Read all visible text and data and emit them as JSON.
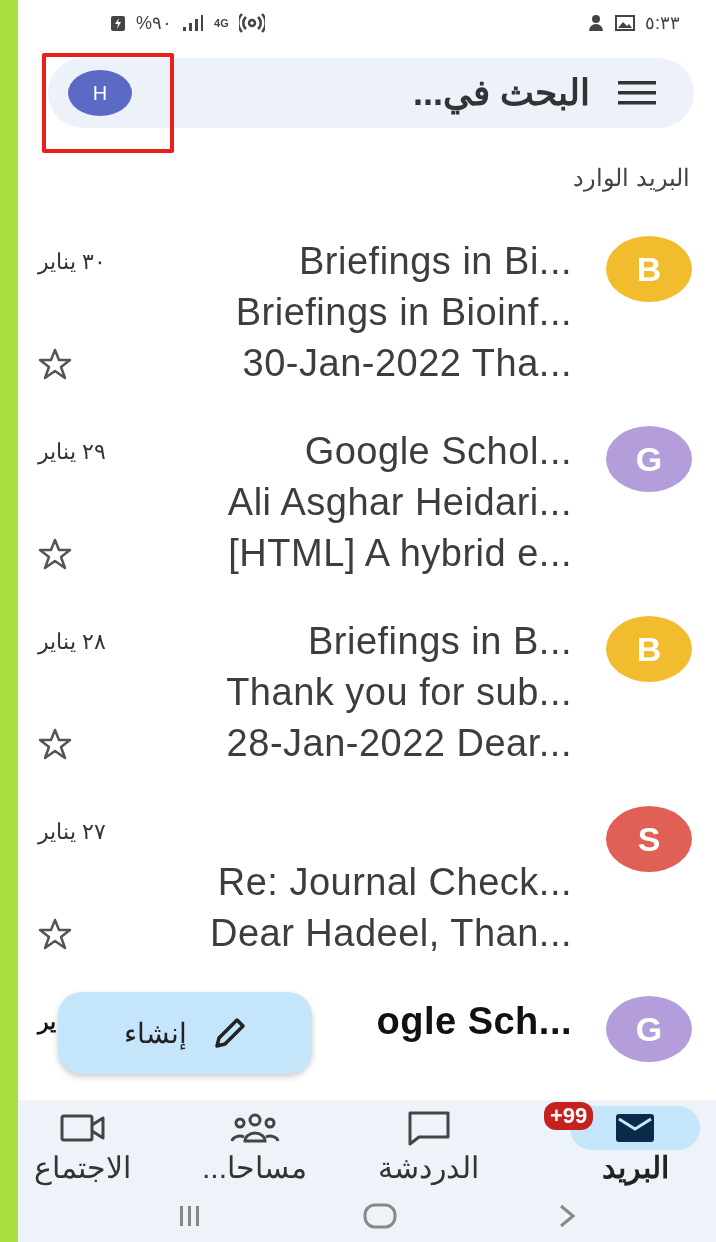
{
  "status_bar": {
    "battery": "%٩٠",
    "network": "4G",
    "time": "٥:٣٣"
  },
  "search": {
    "placeholder": "البحث في...",
    "avatar_letter": "H",
    "highlighted": true
  },
  "folder_label": "البريد الوارد",
  "emails": [
    {
      "avatar_letter": "B",
      "color": "#f2bc2f",
      "sender": "Briefings in Bi...",
      "date": "٣٠ يناير",
      "subject": "Briefings in Bioinf...",
      "preview": "30-Jan-2022 Tha...",
      "starred": false,
      "unread": false
    },
    {
      "avatar_letter": "G",
      "color": "#b39ddb",
      "sender": "Google Schol...",
      "date": "٢٩ يناير",
      "subject": "Ali Asghar Heidari...",
      "preview": "[HTML] A hybrid e...",
      "starred": false,
      "unread": false
    },
    {
      "avatar_letter": "B",
      "color": "#f2bc2f",
      "sender": "Briefings in B...",
      "date": "٢٨ يناير",
      "subject": "Thank you for sub...",
      "preview": "28-Jan-2022 Dear...",
      "starred": false,
      "unread": false
    },
    {
      "avatar_letter": "S",
      "color": "#e06055",
      "date": "٢٧ يناير",
      "subject": "Re: Journal Check...",
      "preview": "Dear Hadeel, Than...",
      "starred": false,
      "unread": false
    },
    {
      "avatar_letter": "G",
      "color": "#b39ddb",
      "sender": "ogle Sch...",
      "date": "ير",
      "unread": true
    }
  ],
  "compose": {
    "label": "إنشاء"
  },
  "nav": [
    {
      "kind": "mail",
      "label": "البريد",
      "selected": true,
      "badge": "99+"
    },
    {
      "kind": "chat",
      "label": "الدردشة",
      "selected": false
    },
    {
      "kind": "spaces",
      "label": "مساحا...",
      "selected": false
    },
    {
      "kind": "meet",
      "label": "الاجتماع",
      "selected": false
    }
  ]
}
